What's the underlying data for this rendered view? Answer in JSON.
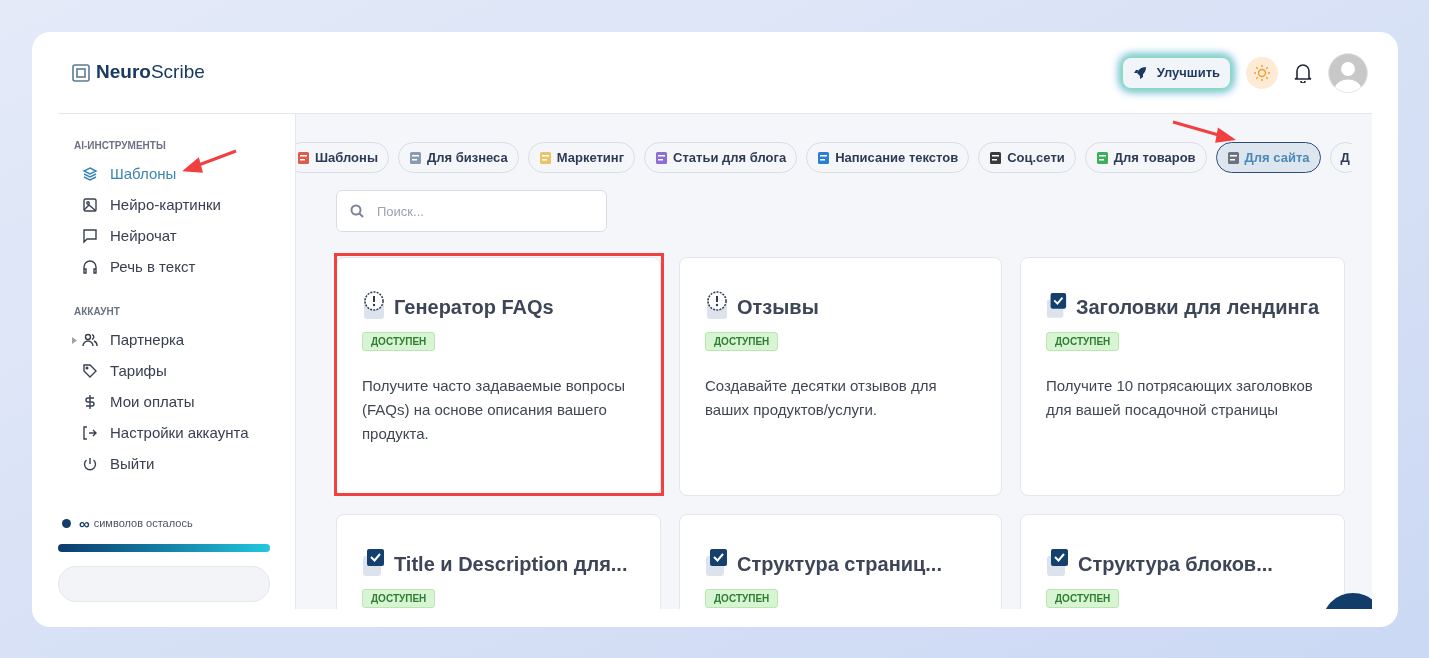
{
  "logo": {
    "text": "**Neuro**Scribe"
  },
  "header": {
    "upgrade_button": "Улучшить"
  },
  "sidebar": {
    "sections": [
      {
        "heading": "AI-ИНСТРУМЕНТЫ",
        "items": [
          {
            "label": "Шаблоны",
            "kind": "link",
            "selected": true
          },
          {
            "label": "Нейро-картинки",
            "kind": "link",
            "selected": false
          },
          {
            "label": "Нейрочат",
            "kind": "link",
            "selected": false
          },
          {
            "label": "Речь в текст",
            "kind": "link",
            "selected": false
          }
        ]
      },
      {
        "heading": "АККАУНТ",
        "items": [
          {
            "label": "Партнерка",
            "kind": "group",
            "selected": false
          },
          {
            "label": "Тарифы",
            "kind": "link",
            "selected": false
          },
          {
            "label": "Мои оплаты",
            "kind": "link",
            "selected": false
          },
          {
            "label": "Настройки аккаунта",
            "kind": "link",
            "selected": false
          },
          {
            "label": "Выйти",
            "kind": "link",
            "selected": false
          }
        ]
      }
    ],
    "credits": {
      "symbol": "∞",
      "text": "символов осталось",
      "level": 1
    }
  },
  "chips": [
    {
      "label": "Шаблоны",
      "selected": false
    },
    {
      "label": "Для бизнеса",
      "selected": false
    },
    {
      "label": "Маркетинг",
      "selected": false
    },
    {
      "label": "Статьи для блога",
      "selected": false
    },
    {
      "label": "Написание текстов",
      "selected": false
    },
    {
      "label": "Соц.сети",
      "selected": false
    },
    {
      "label": "Для товаров",
      "selected": false
    },
    {
      "label": "Для сайта",
      "selected": true
    },
    {
      "label": "Д",
      "selected": false
    }
  ],
  "search": {
    "placeholder": "Поиск..."
  },
  "cards": [
    {
      "kind": "notice",
      "title": "Генератор FAQs",
      "badge": "ДОСТУПЕН",
      "description": "Получите часто задаваемые вопросы (FAQs) на основе описания вашего продукта."
    },
    {
      "kind": "notice",
      "title": "Отзывы",
      "badge": "ДОСТУПЕН",
      "description": "Создавайте десятки отзывов для ваших продуктов/услуги."
    },
    {
      "kind": "checklist",
      "title": "Заголовки для лендинга",
      "badge": "ДОСТУПЕН",
      "description": "Получите 10 потрясающих заголовков для вашей посадочной страницы"
    },
    {
      "kind": "checklist",
      "title": "Title и Description для...",
      "badge": "ДОСТУПЕН"
    },
    {
      "kind": "checklist",
      "title": "Структура страниц...",
      "badge": "ДОСТУПЕН"
    },
    {
      "kind": "checklist",
      "title": "Структура блоков...",
      "badge": "ДОСТУПЕН"
    }
  ]
}
